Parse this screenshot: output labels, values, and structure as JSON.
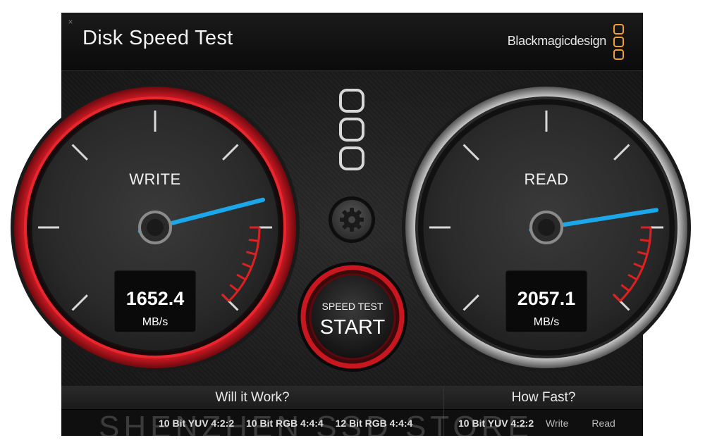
{
  "window": {
    "title": "Disk Speed Test",
    "close_glyph": "×",
    "brand": "Blackmagicdesign"
  },
  "write_gauge": {
    "label": "WRITE",
    "value": "1652.4",
    "unit": "MB/s",
    "needle_level": 0.78,
    "ring_color": "#c0141e"
  },
  "read_gauge": {
    "label": "READ",
    "value": "2057.1",
    "unit": "MB/s",
    "needle_level": 0.8,
    "ring_color": "#9a9a9a"
  },
  "settings": {
    "icon": "gear-icon"
  },
  "start_button": {
    "top_label": "SPEED TEST",
    "main_label": "START"
  },
  "will_it_work": {
    "title": "Will it Work?",
    "formats": [
      "10 Bit YUV 4:2:2",
      "10 Bit RGB 4:4:4",
      "12 Bit RGB 4:4:4"
    ]
  },
  "how_fast": {
    "title": "How Fast?",
    "format": "10 Bit YUV 4:2:2",
    "col_write": "Write",
    "col_read": "Read"
  },
  "watermark": "SHENZHEN SSD STORE",
  "colors": {
    "accent_red": "#e02020",
    "needle_blue": "#1aa8ea",
    "logo_orange": "#f0a030"
  }
}
